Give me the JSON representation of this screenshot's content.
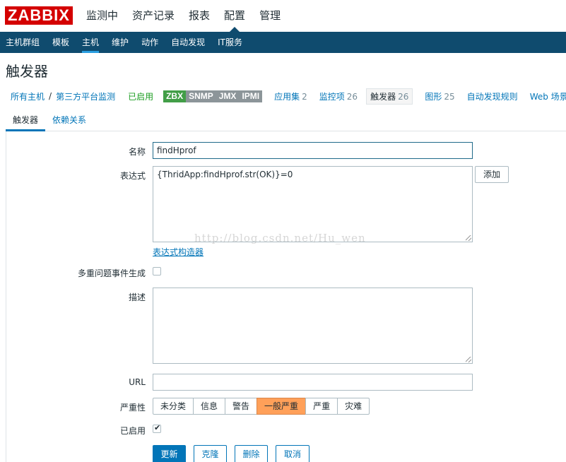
{
  "logo": "ZABBIX",
  "main_nav": [
    "监测中",
    "资产记录",
    "报表",
    "配置",
    "管理"
  ],
  "sub_nav": [
    "主机群组",
    "模板",
    "主机",
    "维护",
    "动作",
    "自动发现",
    "IT服务"
  ],
  "page_title": "触发器",
  "host_nav": {
    "all_hosts": "所有主机",
    "separator": "/",
    "host_name": "第三方平台监测",
    "status": "已启用",
    "badges": [
      "ZBX",
      "SNMP",
      "JMX",
      "IPMI"
    ],
    "links": [
      {
        "label": "应用集",
        "count": "2"
      },
      {
        "label": "监控项",
        "count": "26"
      },
      {
        "label": "触发器",
        "count": "26"
      },
      {
        "label": "图形",
        "count": "25"
      },
      {
        "label": "自动发现规则",
        "count": ""
      },
      {
        "label": "Web 场景",
        "count": ""
      }
    ]
  },
  "tabs": [
    "触发器",
    "依赖关系"
  ],
  "form": {
    "name_label": "名称",
    "name_value": "findHprof",
    "expression_label": "表达式",
    "expression_value": "{ThridApp:findHprof.str(OK)}=0",
    "add_button": "添加",
    "expression_builder": "表达式构造器",
    "multiple_events_label": "多重问题事件生成",
    "description_label": "描述",
    "description_value": "",
    "url_label": "URL",
    "url_value": "",
    "severity_label": "严重性",
    "severity_options": [
      "未分类",
      "信息",
      "警告",
      "一般严重",
      "严重",
      "灾难"
    ],
    "severity_selected": "一般严重",
    "enabled_label": "已启用",
    "enabled_checked": true,
    "multiple_events_checked": false
  },
  "buttons": {
    "update": "更新",
    "clone": "克隆",
    "delete": "删除",
    "cancel": "取消"
  },
  "watermark": "http://blog.csdn.net/Hu_wen",
  "colors": {
    "brand": "#d40000",
    "subnav_bg": "#0f4b6e",
    "link": "#0275b8",
    "enabled": "#1e9f24",
    "zbx_badge": "#429e47",
    "inactive_badge": "#8c9599",
    "severity_average": "#ffa059"
  }
}
